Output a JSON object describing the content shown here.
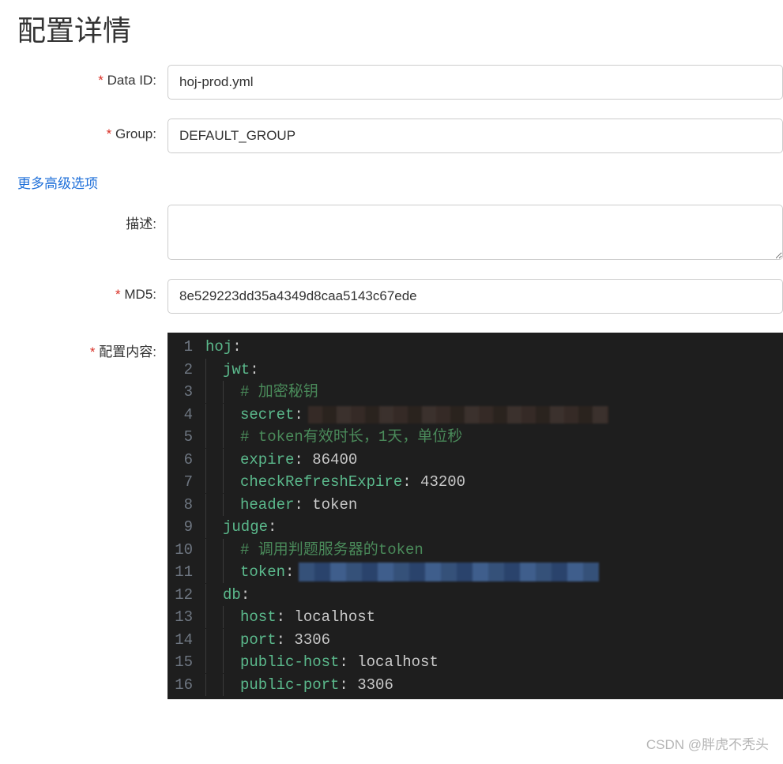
{
  "title": "配置详情",
  "labels": {
    "dataId": "Data ID:",
    "group": "Group:",
    "advanced": "更多高级选项",
    "description": "描述:",
    "md5": "MD5:",
    "content": "配置内容:"
  },
  "values": {
    "dataId": "hoj-prod.yml",
    "group": "DEFAULT_GROUP",
    "description": "",
    "md5": "8e529223dd35a4349d8caa5143c67ede"
  },
  "codeLines": [
    {
      "n": 1,
      "indent": 0,
      "tokens": [
        [
          "key",
          "hoj"
        ],
        [
          "colon",
          ":"
        ]
      ]
    },
    {
      "n": 2,
      "indent": 1,
      "tokens": [
        [
          "key",
          "jwt"
        ],
        [
          "colon",
          ":"
        ]
      ]
    },
    {
      "n": 3,
      "indent": 2,
      "tokens": [
        [
          "comment",
          "# 加密秘钥"
        ]
      ]
    },
    {
      "n": 4,
      "indent": 2,
      "tokens": [
        [
          "key",
          "secret"
        ],
        [
          "colon",
          ":"
        ],
        [
          "redacted-brown",
          ""
        ]
      ]
    },
    {
      "n": 5,
      "indent": 2,
      "tokens": [
        [
          "comment",
          "# token有效时长，1天，单位秒"
        ]
      ]
    },
    {
      "n": 6,
      "indent": 2,
      "tokens": [
        [
          "key",
          "expire"
        ],
        [
          "colon",
          ": "
        ],
        [
          "number",
          "86400"
        ]
      ]
    },
    {
      "n": 7,
      "indent": 2,
      "tokens": [
        [
          "key",
          "checkRefreshExpire"
        ],
        [
          "colon",
          ": "
        ],
        [
          "number",
          "43200"
        ]
      ]
    },
    {
      "n": 8,
      "indent": 2,
      "tokens": [
        [
          "key",
          "header"
        ],
        [
          "colon",
          ": "
        ],
        [
          "value",
          "token"
        ]
      ]
    },
    {
      "n": 9,
      "indent": 1,
      "tokens": [
        [
          "key",
          "judge"
        ],
        [
          "colon",
          ":"
        ]
      ]
    },
    {
      "n": 10,
      "indent": 2,
      "tokens": [
        [
          "comment",
          "# 调用判题服务器的token"
        ]
      ]
    },
    {
      "n": 11,
      "indent": 2,
      "tokens": [
        [
          "key",
          "token"
        ],
        [
          "colon",
          ":"
        ],
        [
          "redacted-blue",
          ""
        ]
      ]
    },
    {
      "n": 12,
      "indent": 1,
      "tokens": [
        [
          "key",
          "db"
        ],
        [
          "colon",
          ":"
        ]
      ]
    },
    {
      "n": 13,
      "indent": 2,
      "tokens": [
        [
          "key",
          "host"
        ],
        [
          "colon",
          ": "
        ],
        [
          "value",
          "localhost"
        ]
      ]
    },
    {
      "n": 14,
      "indent": 2,
      "tokens": [
        [
          "key",
          "port"
        ],
        [
          "colon",
          ": "
        ],
        [
          "number",
          "3306"
        ]
      ]
    },
    {
      "n": 15,
      "indent": 2,
      "tokens": [
        [
          "key",
          "public-host"
        ],
        [
          "colon",
          ": "
        ],
        [
          "value",
          "localhost"
        ]
      ]
    },
    {
      "n": 16,
      "indent": 2,
      "tokens": [
        [
          "key",
          "public-port"
        ],
        [
          "colon",
          ": "
        ],
        [
          "number",
          "3306"
        ]
      ]
    }
  ],
  "watermark": "CSDN @胖虎不秃头"
}
